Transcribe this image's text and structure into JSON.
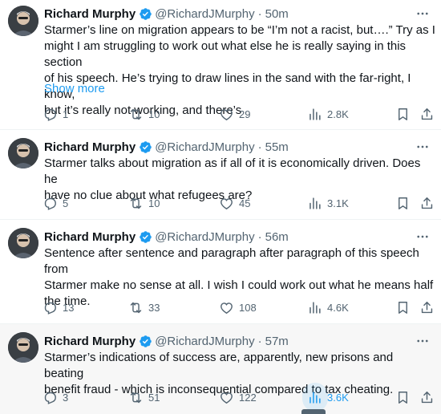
{
  "tweets": [
    {
      "author": "Richard Murphy",
      "handle": "@RichardJMurphy",
      "separator": "·",
      "time": "50m",
      "text": "Starmer’s line on migration appears to be “I’m not a racist, but….” Try as I\nmight I am struggling to work out what else he is really saying in this section\nof his speech. He’s trying to draw lines in the sand with the far-right, I know,\nbut it’s really not working, and there’s",
      "show_more": "Show more",
      "replies": "1",
      "retweets": "10",
      "likes": "29",
      "views": "2.8K"
    },
    {
      "author": "Richard Murphy",
      "handle": "@RichardJMurphy",
      "separator": "·",
      "time": "55m",
      "text": "Starmer talks about migration as if all of it is economically driven. Does he\nhave no clue about what refugees are?",
      "replies": "5",
      "retweets": "10",
      "likes": "45",
      "views": "3.1K"
    },
    {
      "author": "Richard Murphy",
      "handle": "@RichardJMurphy",
      "separator": "·",
      "time": "56m",
      "text": "Sentence after sentence and paragraph after paragraph of this speech from\nStarmer make no sense at all. I wish I could work out what he means half\nthe time.",
      "replies": "13",
      "retweets": "33",
      "likes": "108",
      "views": "4.6K"
    },
    {
      "author": "Richard Murphy",
      "handle": "@RichardJMurphy",
      "separator": "·",
      "time": "57m",
      "text": "Starmer’s indications of success are, apparently, new prisons and beating\nbenefit fraud - which is inconsequential compared to tax cheating.",
      "replies": "3",
      "retweets": "51",
      "likes": "122",
      "views": "3.6K"
    }
  ],
  "colors": {
    "text": "#0f1419",
    "secondary": "#536471",
    "accent": "#1d9bf0",
    "divider": "#eff3f4",
    "hover_bg": "#f7f7f7"
  },
  "icons": [
    "verified-badge-icon",
    "more-options-icon",
    "reply-icon",
    "retweet-icon",
    "like-icon",
    "views-icon",
    "bookmark-icon",
    "share-icon"
  ]
}
